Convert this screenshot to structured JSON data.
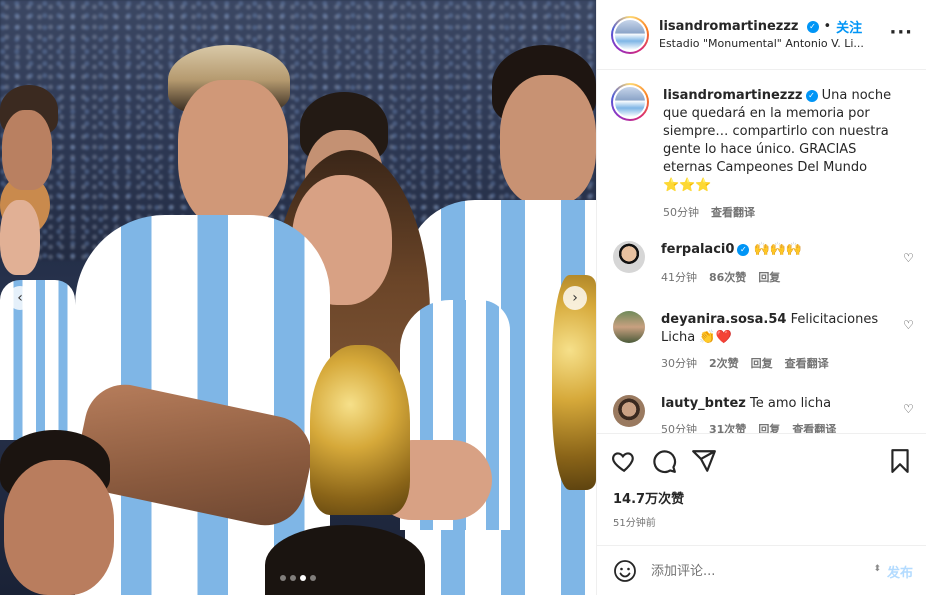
{
  "post": {
    "username": "lisandromartinezzz",
    "follow_label": "关注",
    "separator": "•",
    "location": "Estadio \"Monumental\" Antonio V. Li...",
    "more_icon": "more-options-icon"
  },
  "caption": {
    "username": "lisandromartinezzz",
    "text": "Una noche que quedará en la memoria por siempre… compartirlo con nuestra gente lo hace único. GRACIAS eternas Campeones Del Mundo ⭐⭐⭐",
    "time": "50分钟",
    "translate": "查看翻译"
  },
  "comments": [
    {
      "username": "ferpalaci0",
      "verified": true,
      "text": "🙌🙌🙌",
      "time": "41分钟",
      "likes": "86次赞",
      "reply": "回复",
      "translate": ""
    },
    {
      "username": "deyanira.sosa.54",
      "verified": false,
      "text": "Felicitaciones Licha 👏❤️",
      "time": "30分钟",
      "likes": "2次赞",
      "reply": "回复",
      "translate": "查看翻译"
    },
    {
      "username": "lauty_bntez",
      "verified": false,
      "text": "Te amo licha",
      "time": "50分钟",
      "likes": "31次赞",
      "reply": "回复",
      "translate": "查看翻译"
    }
  ],
  "actions": {
    "likes": "14.7万次赞",
    "time": "51分钟前"
  },
  "composer": {
    "placeholder": "添加评论...",
    "post_label": "发布"
  },
  "carousel": {
    "prev": "‹",
    "next": "›",
    "slide_count": 4,
    "active_index": 2
  },
  "colors": {
    "accent": "#0095f6",
    "like_red": "#ed4956",
    "muted": "#737373",
    "border": "#efefef"
  }
}
